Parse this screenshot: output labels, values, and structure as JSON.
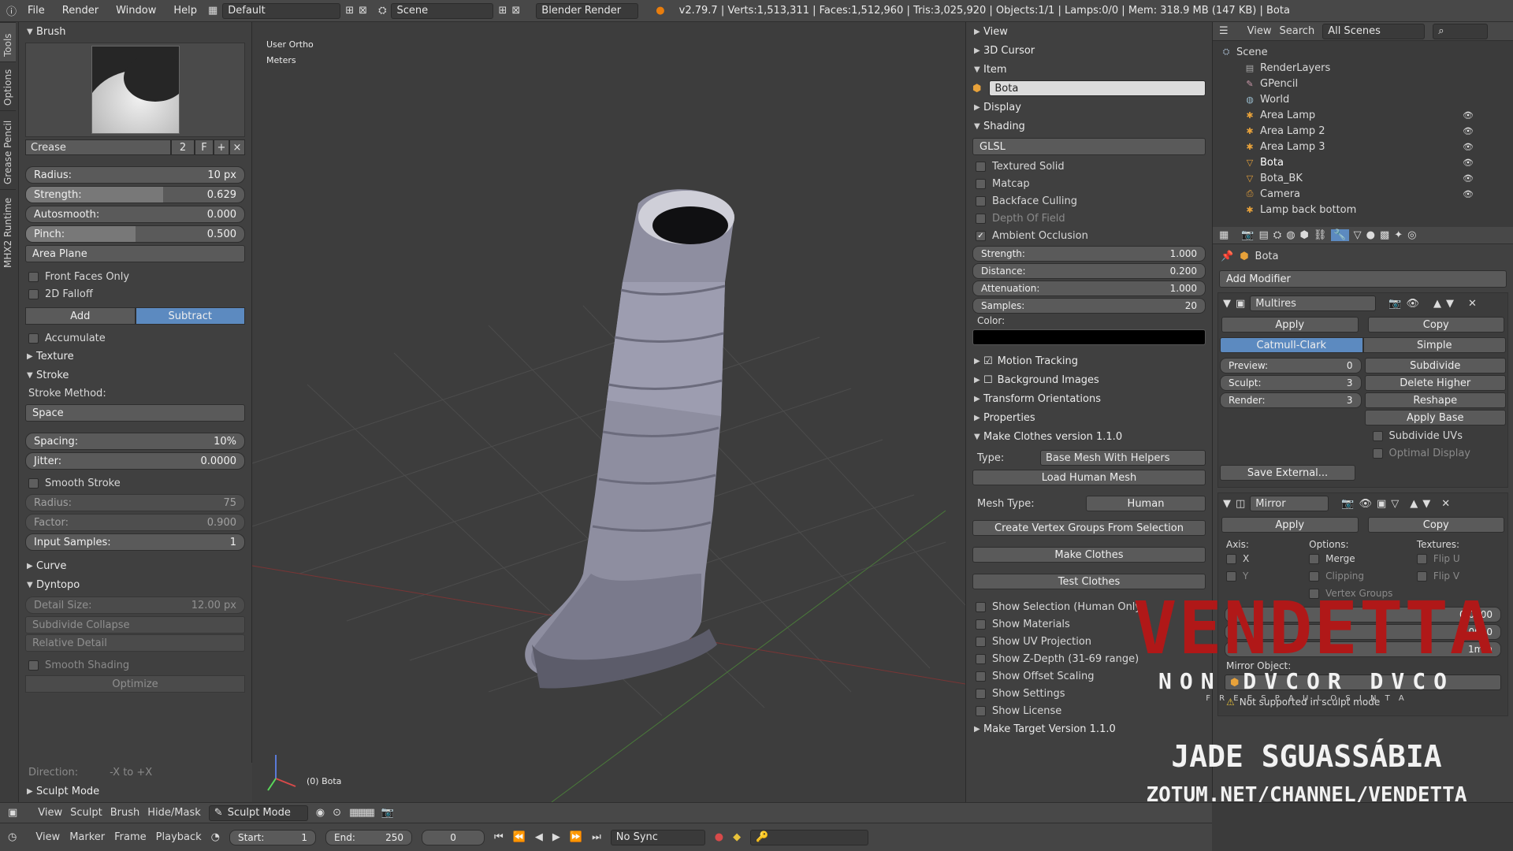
{
  "topbar": {
    "menus": [
      "File",
      "Render",
      "Window",
      "Help"
    ],
    "layout": "Default",
    "scene": "Scene",
    "engine": "Blender Render",
    "stats": "v2.79.7 | Verts:1,513,311 | Faces:1,512,960 | Tris:3,025,920 | Objects:1/1 | Lamps:0/0 | Mem: 318.9 MB (147 KB) | Bota"
  },
  "lefttabs": [
    "Tools",
    "Options",
    "Grease Pencil",
    "MHX2 Runtime"
  ],
  "brush": {
    "header": "Brush",
    "name": "Crease",
    "users": "2",
    "fake": "F",
    "radius_label": "Radius:",
    "radius": "10 px",
    "strength_label": "Strength:",
    "strength": "0.629",
    "strength_frac": 0.629,
    "autosmooth_label": "Autosmooth:",
    "autosmooth": "0.000",
    "pinch_label": "Pinch:",
    "pinch": "0.500",
    "pinch_frac": 0.5,
    "area": "Area Plane",
    "front_faces": "Front Faces Only",
    "falloff": "2D Falloff",
    "add": "Add",
    "subtract": "Subtract",
    "accumulate": "Accumulate"
  },
  "texture": {
    "header": "Texture"
  },
  "stroke": {
    "header": "Stroke",
    "method_label": "Stroke Method:",
    "method": "Space",
    "spacing_label": "Spacing:",
    "spacing": "10%",
    "jitter_label": "Jitter:",
    "jitter": "0.0000",
    "smooth": "Smooth Stroke",
    "radius_label": "Radius:",
    "radius": "75",
    "factor_label": "Factor:",
    "factor": "0.900",
    "input_label": "Input Samples:",
    "input": "1"
  },
  "curve": {
    "header": "Curve"
  },
  "dyntopo": {
    "header": "Dyntopo",
    "detail_label": "Detail Size:",
    "detail": "12.00 px",
    "collapse": "Subdivide Collapse",
    "relative": "Relative Detail",
    "smooth": "Smooth Shading",
    "optimize": "Optimize",
    "direction_label": "Direction:",
    "direction": "-X to +X"
  },
  "sculptmode": {
    "header": "Sculpt Mode"
  },
  "viewport": {
    "view": "User Ortho",
    "units": "Meters",
    "object": "(0) Bota"
  },
  "rpanel": {
    "view": "View",
    "cursor": "3D Cursor",
    "item": "Item",
    "object_name": "Bota",
    "display": "Display",
    "shading": "Shading",
    "glsl": "GLSL",
    "textured": "Textured Solid",
    "matcap": "Matcap",
    "backface": "Backface Culling",
    "dof": "Depth Of Field",
    "ao": "Ambient Occlusion",
    "ao_strength_label": "Strength:",
    "ao_strength": "1.000",
    "ao_distance_label": "Distance:",
    "ao_distance": "0.200",
    "ao_atten_label": "Attenuation:",
    "ao_atten": "1.000",
    "ao_samples_label": "Samples:",
    "ao_samples": "20",
    "color_label": "Color:",
    "motion": "Motion Tracking",
    "bg": "Background Images",
    "transform": "Transform Orientations",
    "properties": "Properties",
    "makeclothes": "Make Clothes version 1.1.0",
    "type_label": "Type:",
    "type": "Base Mesh  With Helpers",
    "load_human": "Load Human Mesh",
    "mesh_type_label": "Mesh Type:",
    "mesh_type": "Human",
    "create_groups": "Create Vertex Groups From Selection",
    "make_clothes": "Make Clothes",
    "test_clothes": "Test Clothes",
    "show_selection": "Show Selection (Human Only)",
    "show_materials": "Show Materials",
    "show_uv": "Show UV Projection",
    "show_z": "Show Z-Depth (31-69 range)",
    "show_offset": "Show Offset Scaling",
    "show_settings": "Show Settings",
    "show_license": "Show License",
    "make_target": "Make Target  Version 1.1.0"
  },
  "outliner": {
    "view": "View",
    "search": "Search",
    "scenes": "All Scenes",
    "items": [
      "Scene",
      "RenderLayers",
      "GPencil",
      "World",
      "Area Lamp",
      "Area Lamp 2",
      "Area Lamp 3",
      "Bota",
      "Bota_BK",
      "Camera",
      "Lamp back bottom"
    ]
  },
  "props": {
    "object": "Bota",
    "add_modifier": "Add Modifier",
    "multires": "Multires",
    "apply": "Apply",
    "copy": "Copy",
    "catmull": "Catmull-Clark",
    "simple": "Simple",
    "preview_label": "Preview:",
    "preview": "0",
    "sculpt_label": "Sculpt:",
    "sculpt": "3",
    "render_label": "Render:",
    "render": "3",
    "subdivide": "Subdivide",
    "delete_higher": "Delete Higher",
    "reshape": "Reshape",
    "apply_base": "Apply Base",
    "subdivide_uvs": "Subdivide UVs",
    "optimal": "Optimal Display",
    "save_external": "Save External...",
    "mirror": "Mirror",
    "axis": "Axis:",
    "options": "Options:",
    "textures": "Textures:",
    "x": "X",
    "y": "Y",
    "merge": "Merge",
    "clipping": "Clipping",
    "vertex_groups": "Vertex Groups",
    "flip_u": "Flip U",
    "flip_v": "Flip V",
    "val1": "0.0000",
    "val2": "0.0000",
    "limit": "1mm",
    "mirror_object": "Mirror Object:",
    "warning": "Not supported in sculpt mode"
  },
  "watermark": {
    "title": "VENDETTA",
    "sub": "NON DVCOR DVCO",
    "sub2": "F R E E   S P A U L O   S I N   T A",
    "author": "JADE SGUASSÁBIA",
    "url": "ZOTUM.NET/CHANNEL/VENDETTA"
  },
  "bottombar": {
    "view": "View",
    "sculpt": "Sculpt",
    "brush": "Brush",
    "hide": "Hide/Mask",
    "mode": "Sculpt Mode"
  },
  "timeline": {
    "view": "View",
    "marker": "Marker",
    "frame": "Frame",
    "playback": "Playback",
    "start_label": "Start:",
    "start": "1",
    "end_label": "End:",
    "end": "250",
    "current": "0",
    "sync": "No Sync"
  }
}
